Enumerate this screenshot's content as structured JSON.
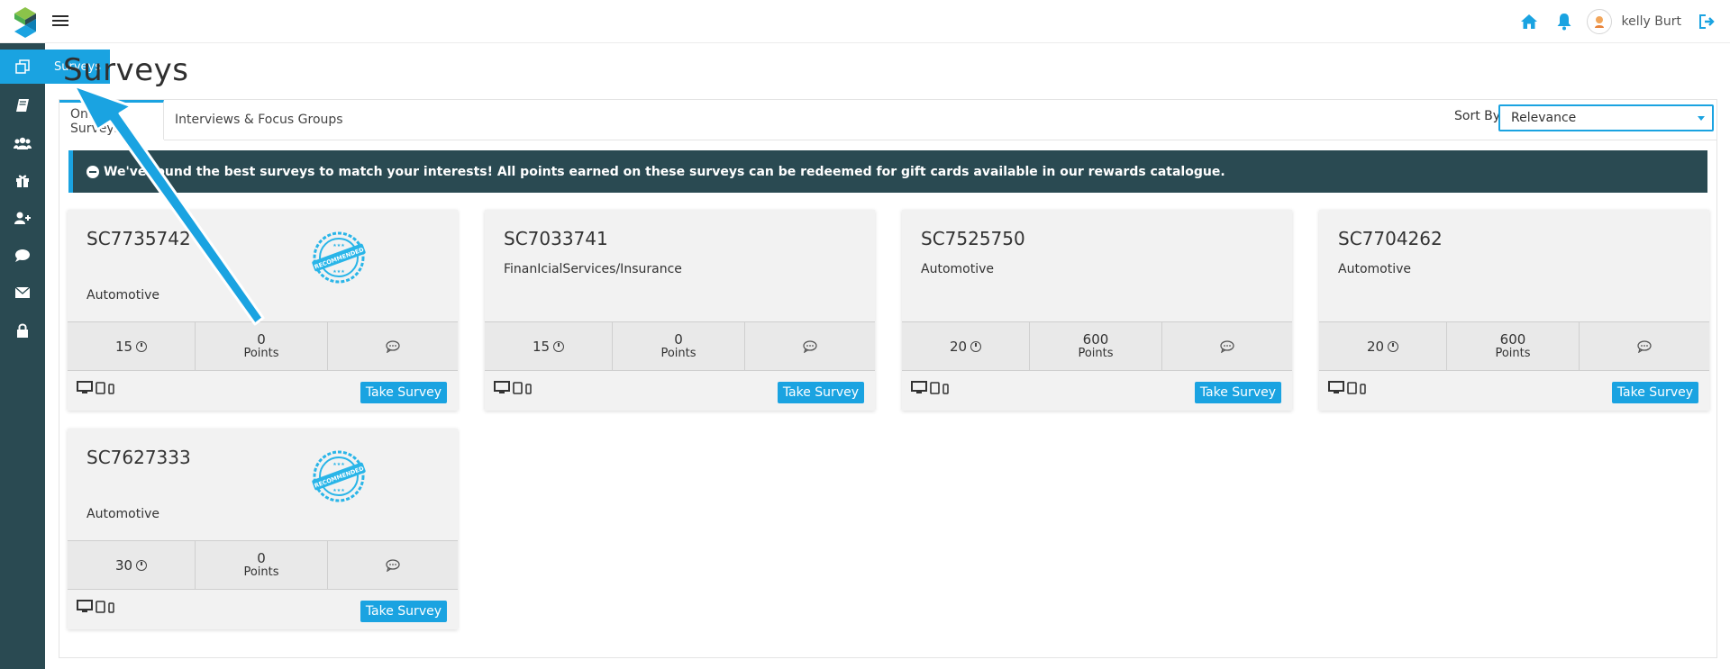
{
  "header": {
    "user_name": "kelly Burt",
    "icons": [
      "home-icon",
      "bell-icon",
      "avatar",
      "logout-icon"
    ],
    "accent_color": "#1aa3e1"
  },
  "sidebar": {
    "items": [
      {
        "icon": "surveys-icon",
        "active": true
      },
      {
        "icon": "book-icon"
      },
      {
        "icon": "users-icon"
      },
      {
        "icon": "gift-icon"
      },
      {
        "icon": "add-user-icon"
      },
      {
        "icon": "chat-icon"
      },
      {
        "icon": "mail-icon"
      },
      {
        "icon": "lock-icon"
      }
    ],
    "tooltip": "Surveys",
    "bg_color": "#2a4a52"
  },
  "page": {
    "title": "Surveys"
  },
  "tabs": [
    {
      "label": "Online Surveys",
      "active": true
    },
    {
      "label": "Interviews & Focus Groups",
      "active": false
    }
  ],
  "sort": {
    "label": "Sort By",
    "value": "Relevance"
  },
  "banner": {
    "text": "We've found the best surveys to match your interests! All points earned on these surveys can be redeemed for gift cards available in our rewards catalogue."
  },
  "cards": [
    {
      "id": "SC7735742",
      "category": "Automotive",
      "recommended": true,
      "minutes": "15",
      "points": "0",
      "points_label": "Points",
      "button": "Take Survey"
    },
    {
      "id": "SC7033741",
      "category": "FinanIcialServices/Insurance",
      "recommended": false,
      "minutes": "15",
      "points": "0",
      "points_label": "Points",
      "button": "Take Survey"
    },
    {
      "id": "SC7525750",
      "category": "Automotive",
      "recommended": false,
      "minutes": "20",
      "points": "600",
      "points_label": "Points",
      "button": "Take Survey"
    },
    {
      "id": "SC7704262",
      "category": "Automotive",
      "recommended": false,
      "minutes": "20",
      "points": "600",
      "points_label": "Points",
      "button": "Take Survey"
    },
    {
      "id": "SC7627333",
      "category": "Automotive",
      "recommended": true,
      "minutes": "30",
      "points": "0",
      "points_label": "Points",
      "button": "Take Survey"
    }
  ]
}
